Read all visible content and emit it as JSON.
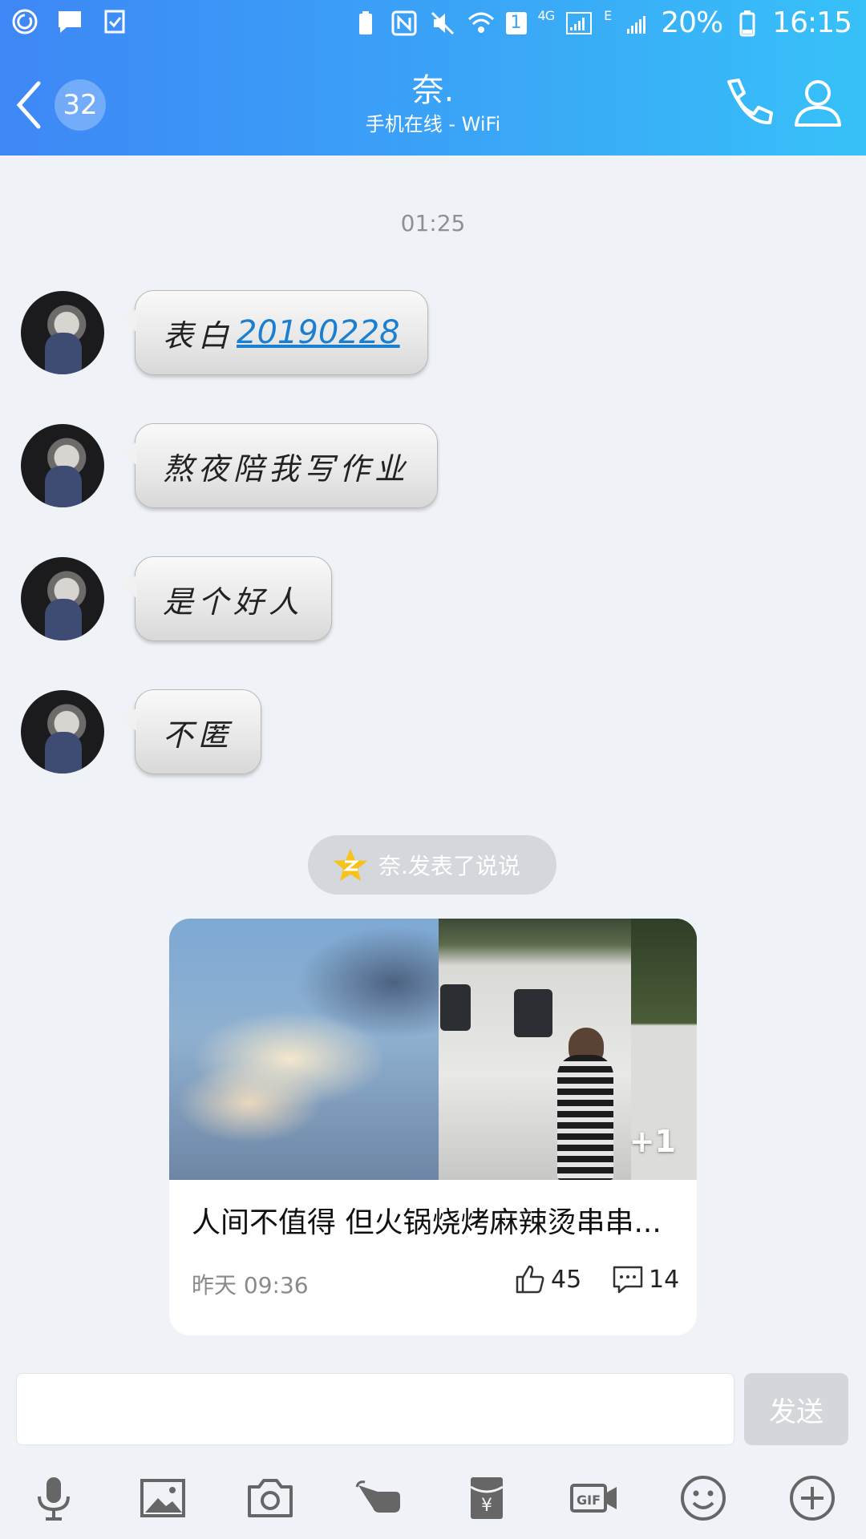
{
  "status_bar": {
    "battery": "20%",
    "time": "16:15",
    "sim_badge": "1",
    "network_4g": "4G",
    "network_e": "E"
  },
  "header": {
    "back_count": "32",
    "title": "奈.",
    "subtitle": "手机在线 - WiFi"
  },
  "chat": {
    "timestamp": "01:25",
    "messages": [
      {
        "text": "表白",
        "link": "20190228"
      },
      {
        "text": "熬夜陪我写作业"
      },
      {
        "text": "是个好人"
      },
      {
        "text": "不匿"
      }
    ],
    "notice": "奈.发表了说说"
  },
  "card": {
    "title": "人间不值得 但火锅烧烤麻辣烫串串...",
    "time": "昨天 09:36",
    "likes": "45",
    "comments": "14",
    "more_images": "+1"
  },
  "input": {
    "value": "",
    "send_label": "发送"
  },
  "icons": {
    "back": "chevron-left-icon",
    "phone": "phone-icon",
    "contact": "user-icon",
    "toolbar": [
      "microphone-icon",
      "image-icon",
      "camera-icon",
      "poke-icon",
      "red-packet-icon",
      "gif-icon",
      "emoji-icon",
      "plus-icon"
    ]
  },
  "colors": {
    "header_start": "#3e87f6",
    "header_end": "#37c1f8",
    "background": "#eff2f6",
    "link": "#1a7fd0"
  }
}
